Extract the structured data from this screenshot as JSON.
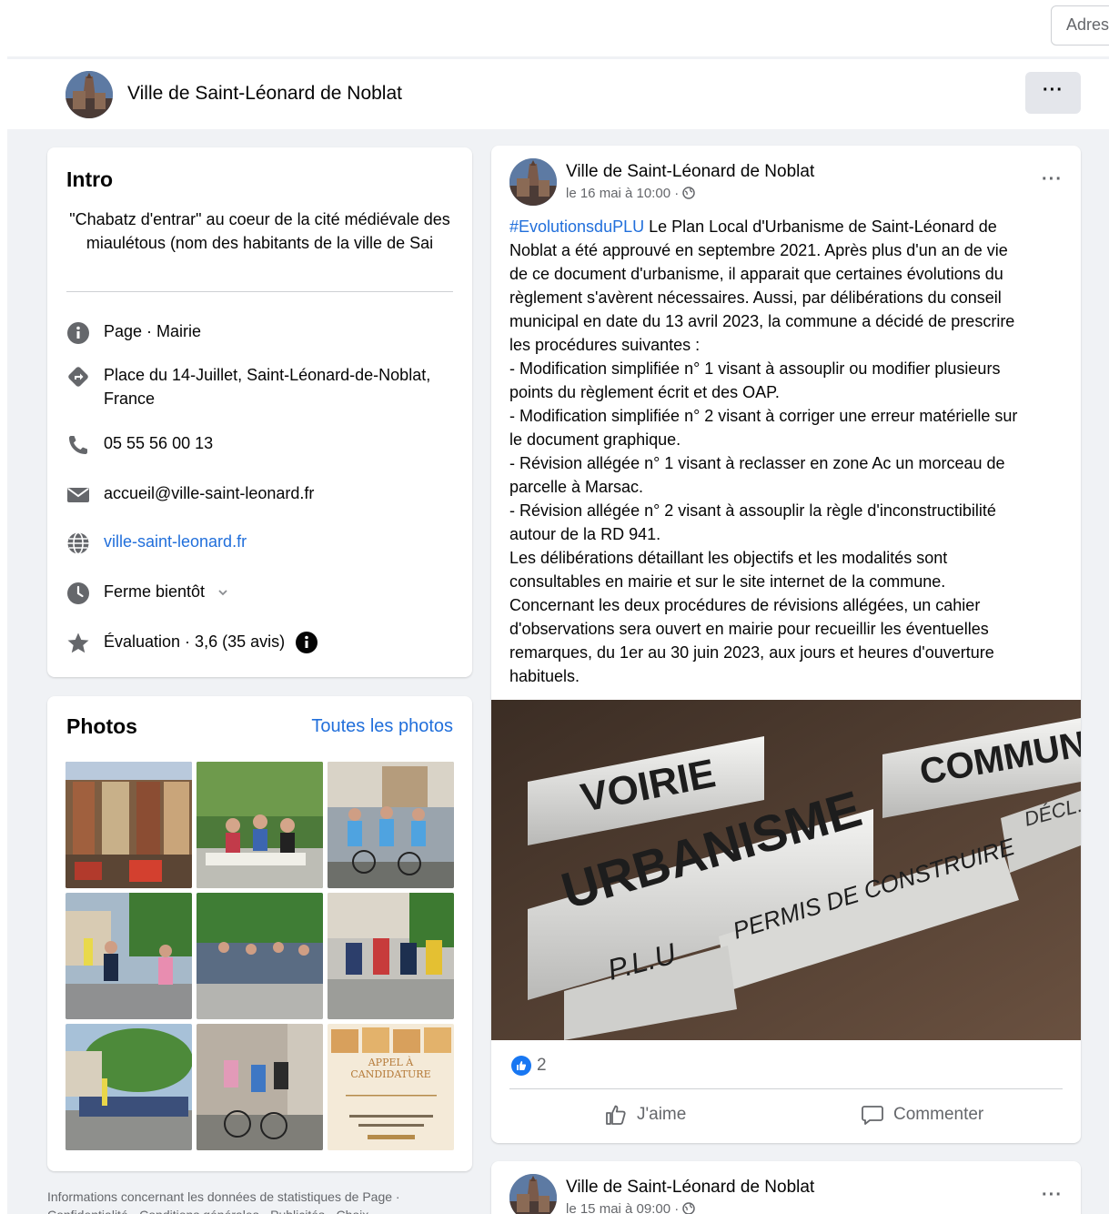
{
  "address_button": {
    "label": "Adresse"
  },
  "page_header": {
    "name": "Ville de Saint-Léonard de Noblat",
    "more_label": "···"
  },
  "intro": {
    "title": "Intro",
    "description": "\"Chabatz d'entrar\" au coeur de la cité médiévale des miaulétous (nom des habitants de la ville de Sai",
    "page_type": "Page · Mairie",
    "address": "Place du 14-Juillet, Saint-Léonard-de-Noblat, France",
    "phone": "05 55 56 00 13",
    "email": "accueil@ville-saint-leonard.fr",
    "website": "ville-saint-leonard.fr",
    "hours": "Ferme bientôt",
    "rating": "Évaluation · 3,6 (35 avis)"
  },
  "photos": {
    "title": "Photos",
    "all_link": "Toutes les photos",
    "poster_title": "APPEL À CANDIDATURE"
  },
  "footer": {
    "text": "Informations concernant les données de statistiques de Page · Confidentialité · Conditions générales · Publicités · Choix"
  },
  "post": {
    "author": "Ville de Saint-Léonard de Noblat",
    "time": "le 16 mai à 10:00 · ",
    "hashtag": "#EvolutionsduPLU",
    "lines": [
      " Le Plan Local d'Urbanisme de Saint-Léonard de",
      "Noblat a été approuvé en septembre 2021. Après plus d'un an de vie",
      "de ce document d'urbanisme, il apparait que certaines évolutions du",
      "règlement s'avèrent nécessaires. Aussi, par délibérations du conseil",
      "municipal en date du 13 avril 2023, la commune a décidé de prescrire",
      "les procédures suivantes :",
      "- Modification simplifiée n° 1 visant à assouplir ou modifier plusieurs",
      "points du règlement écrit et des OAP.",
      "- Modification simplifiée n° 2 visant à corriger une erreur matérielle sur",
      "le document graphique.",
      "- Révision allégée n° 1 visant à reclasser en zone Ac un morceau de",
      "parcelle à Marsac.",
      "- Révision allégée n° 2 visant à assouplir la règle d'inconstructibilité",
      "autour de la RD 941.",
      "Les délibérations détaillant les objectifs et les modalités sont",
      "consultables en mairie et sur le site internet de la commune.",
      "Concernant les deux procédures de révisions allégées, un cahier",
      "d'observations sera ouvert en mairie pour recueillir les éventuelles",
      "remarques, du 1er au 30 juin 2023, aux jours et heures d'ouverture",
      "habituels."
    ],
    "image_labels": {
      "tab1": "VOIRIE",
      "tab2": "COMMUNE",
      "tab3": "URBANISME",
      "tab4": "PERMIS DE CONSTRUIRE",
      "tab5": "DÉCL. P",
      "tab6": "P.L.U"
    },
    "like_count": "2",
    "like_label": "J'aime",
    "comment_label": "Commenter"
  },
  "post2": {
    "author": "Ville de Saint-Léonard de Noblat",
    "time": "le 15 mai à 09:00 · "
  }
}
